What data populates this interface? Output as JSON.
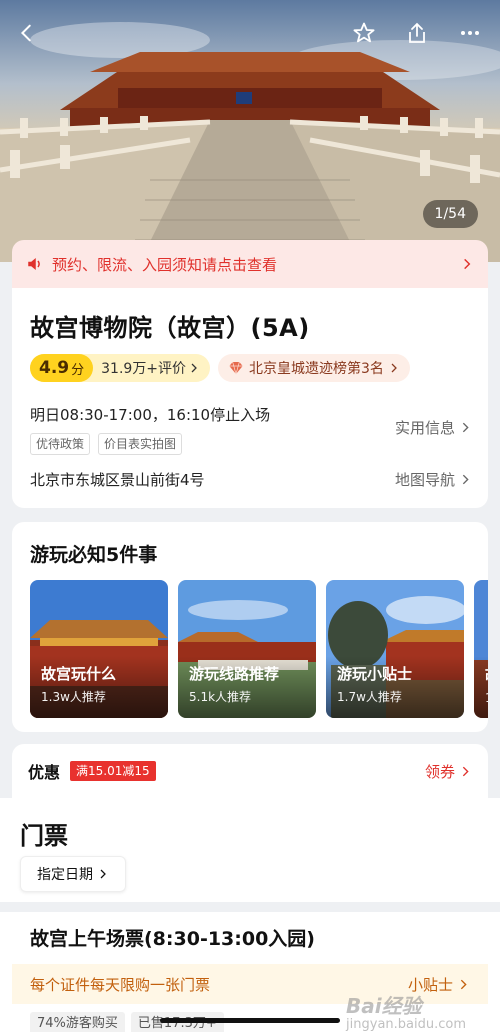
{
  "header": {
    "back_icon": "chevron-left-icon",
    "favorite_icon": "star-icon",
    "share_icon": "share-icon",
    "more_icon": "more-icon",
    "photo_counter": "1/54"
  },
  "notice": {
    "icon": "speaker-icon",
    "text": "预约、限流、入园须知请点击查看",
    "color": "#e0312c"
  },
  "poi": {
    "title": "故宫博物院（故宫）(5A)",
    "score": "4.9",
    "score_unit": "分",
    "reviews": "31.9万+评价",
    "rank_icon": "diamond-icon",
    "rank": "北京皇城遗迹榜第3名",
    "hours": "明日08:30-17:00，16:10停止入场",
    "tags": [
      "优待政策",
      "价目表实拍图"
    ],
    "practical_info": "实用信息",
    "address": "北京市东城区景山前街4号",
    "map_nav": "地图导航"
  },
  "must_do": {
    "title": "游玩必知5件事",
    "items": [
      {
        "name": "故宫玩什么",
        "sub": "1.3w人推荐"
      },
      {
        "name": "游玩线路推荐",
        "sub": "5.1k人推荐"
      },
      {
        "name": "游玩小贴士",
        "sub": "1.7w人推荐"
      },
      {
        "name": "故",
        "sub": "1."
      }
    ]
  },
  "discount": {
    "label": "优惠",
    "badge": "满15.01减15",
    "action": "领券"
  },
  "tickets": {
    "heading": "门票",
    "date_button": "指定日期",
    "item": {
      "title": "故宫上午场票(8:30-13:00入园)",
      "limit_text": "每个证件每天限购一张门票",
      "tips": "小贴士",
      "stats": [
        "74%游客购买",
        "已售17.3万+"
      ]
    }
  },
  "watermark": {
    "text": "Bai经验",
    "sub": "jingyan.baidu.com"
  },
  "colors": {
    "accent_red": "#e0312c",
    "score_yellow": "#ffd21f",
    "tips_orange": "#c2600e"
  }
}
